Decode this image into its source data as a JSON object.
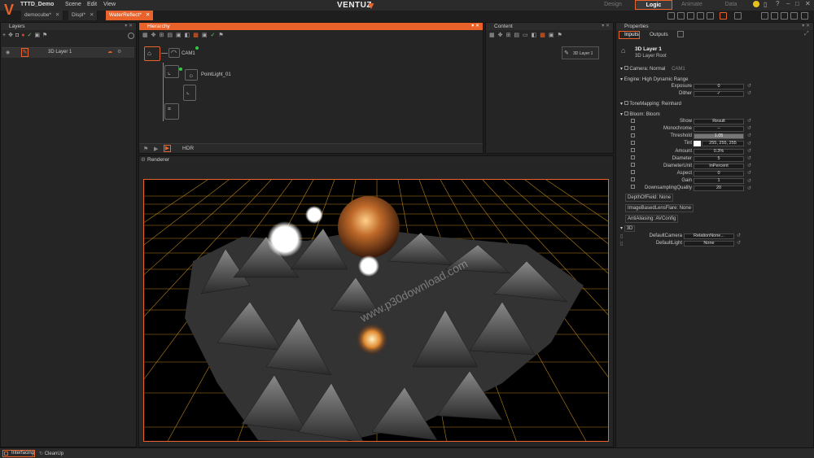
{
  "app": {
    "title": "TTTD_Demo",
    "brand": "VENTUZ"
  },
  "menu": [
    "Scene",
    "Edit",
    "View"
  ],
  "modes": [
    {
      "label": "Design",
      "active": false
    },
    {
      "label": "Logic",
      "active": true
    },
    {
      "label": "Animate",
      "active": false
    },
    {
      "label": "Data",
      "active": false
    }
  ],
  "doc_tabs": [
    {
      "label": "democube*",
      "active": false
    },
    {
      "label": "Displ*",
      "active": false
    },
    {
      "label": "WaterReflect*",
      "active": true
    }
  ],
  "layers": {
    "title": "Layers",
    "items": [
      {
        "label": "3D Layer 1"
      }
    ]
  },
  "hierarchy": {
    "title": "Hierarchy",
    "nodes": {
      "cam": "CAM1",
      "light": "PointLight_01"
    },
    "footer_label": "HDR"
  },
  "content": {
    "title": "Content",
    "item": "3D Layer 1"
  },
  "renderer": {
    "title": "Renderer",
    "watermark": "www.p30download.com"
  },
  "properties": {
    "title": "Properties",
    "tabs": {
      "inputs": "Inputs",
      "outputs": "Outputs"
    },
    "node_name": "3D Layer 1",
    "node_type": "3D Layer Root",
    "camera": {
      "label": "Camera:",
      "mode": "Normal",
      "value": "CAM1"
    },
    "engine": {
      "label": "Engine:",
      "value": "High Dynamic Range"
    },
    "exposure": {
      "label": "Exposure",
      "value": "0"
    },
    "dither": {
      "label": "Dither",
      "value": "✓"
    },
    "tonemapping": {
      "label": "ToneMapping:",
      "value": "Reinhard"
    },
    "bloom": {
      "label": "Bloom:",
      "value": "Bloom"
    },
    "bloom_params": {
      "show": {
        "label": "Show",
        "value": "Result"
      },
      "monochrome": {
        "label": "Monochrome",
        "value": "--"
      },
      "threshold": {
        "label": "Threshold",
        "value": "1.05"
      },
      "tint": {
        "label": "Tint",
        "value": "255, 255, 255"
      },
      "amount": {
        "label": "Amount",
        "value": "0.3%"
      },
      "diameter": {
        "label": "Diameter",
        "value": "5"
      },
      "diameter_unit": {
        "label": "DiameterUnit",
        "value": "InPercent"
      },
      "aspect": {
        "label": "Aspect",
        "value": "0"
      },
      "gain": {
        "label": "Gain",
        "value": "1"
      },
      "downsampling": {
        "label": "DownsamplingQuality",
        "value": "20"
      }
    },
    "depth_of_field": {
      "label": "DepthOfField:",
      "value": "None"
    },
    "lens_flare": {
      "label": "ImageBasedLensFlare:",
      "value": "None"
    },
    "anti_aliasing": {
      "label": "AntiAliasing:",
      "value": "AVConfig"
    },
    "section_3d": "3D",
    "default_camera": {
      "label": "DefaultCamera",
      "value": "RelationNone..."
    },
    "default_light": {
      "label": "DefaultLight",
      "value": "None"
    }
  },
  "bottom": {
    "interfacing": "Interfacing",
    "cleanup": "CleanUp"
  },
  "colors": {
    "accent": "#e8622a",
    "panel": "#252525",
    "grid": "#d99a1e"
  }
}
